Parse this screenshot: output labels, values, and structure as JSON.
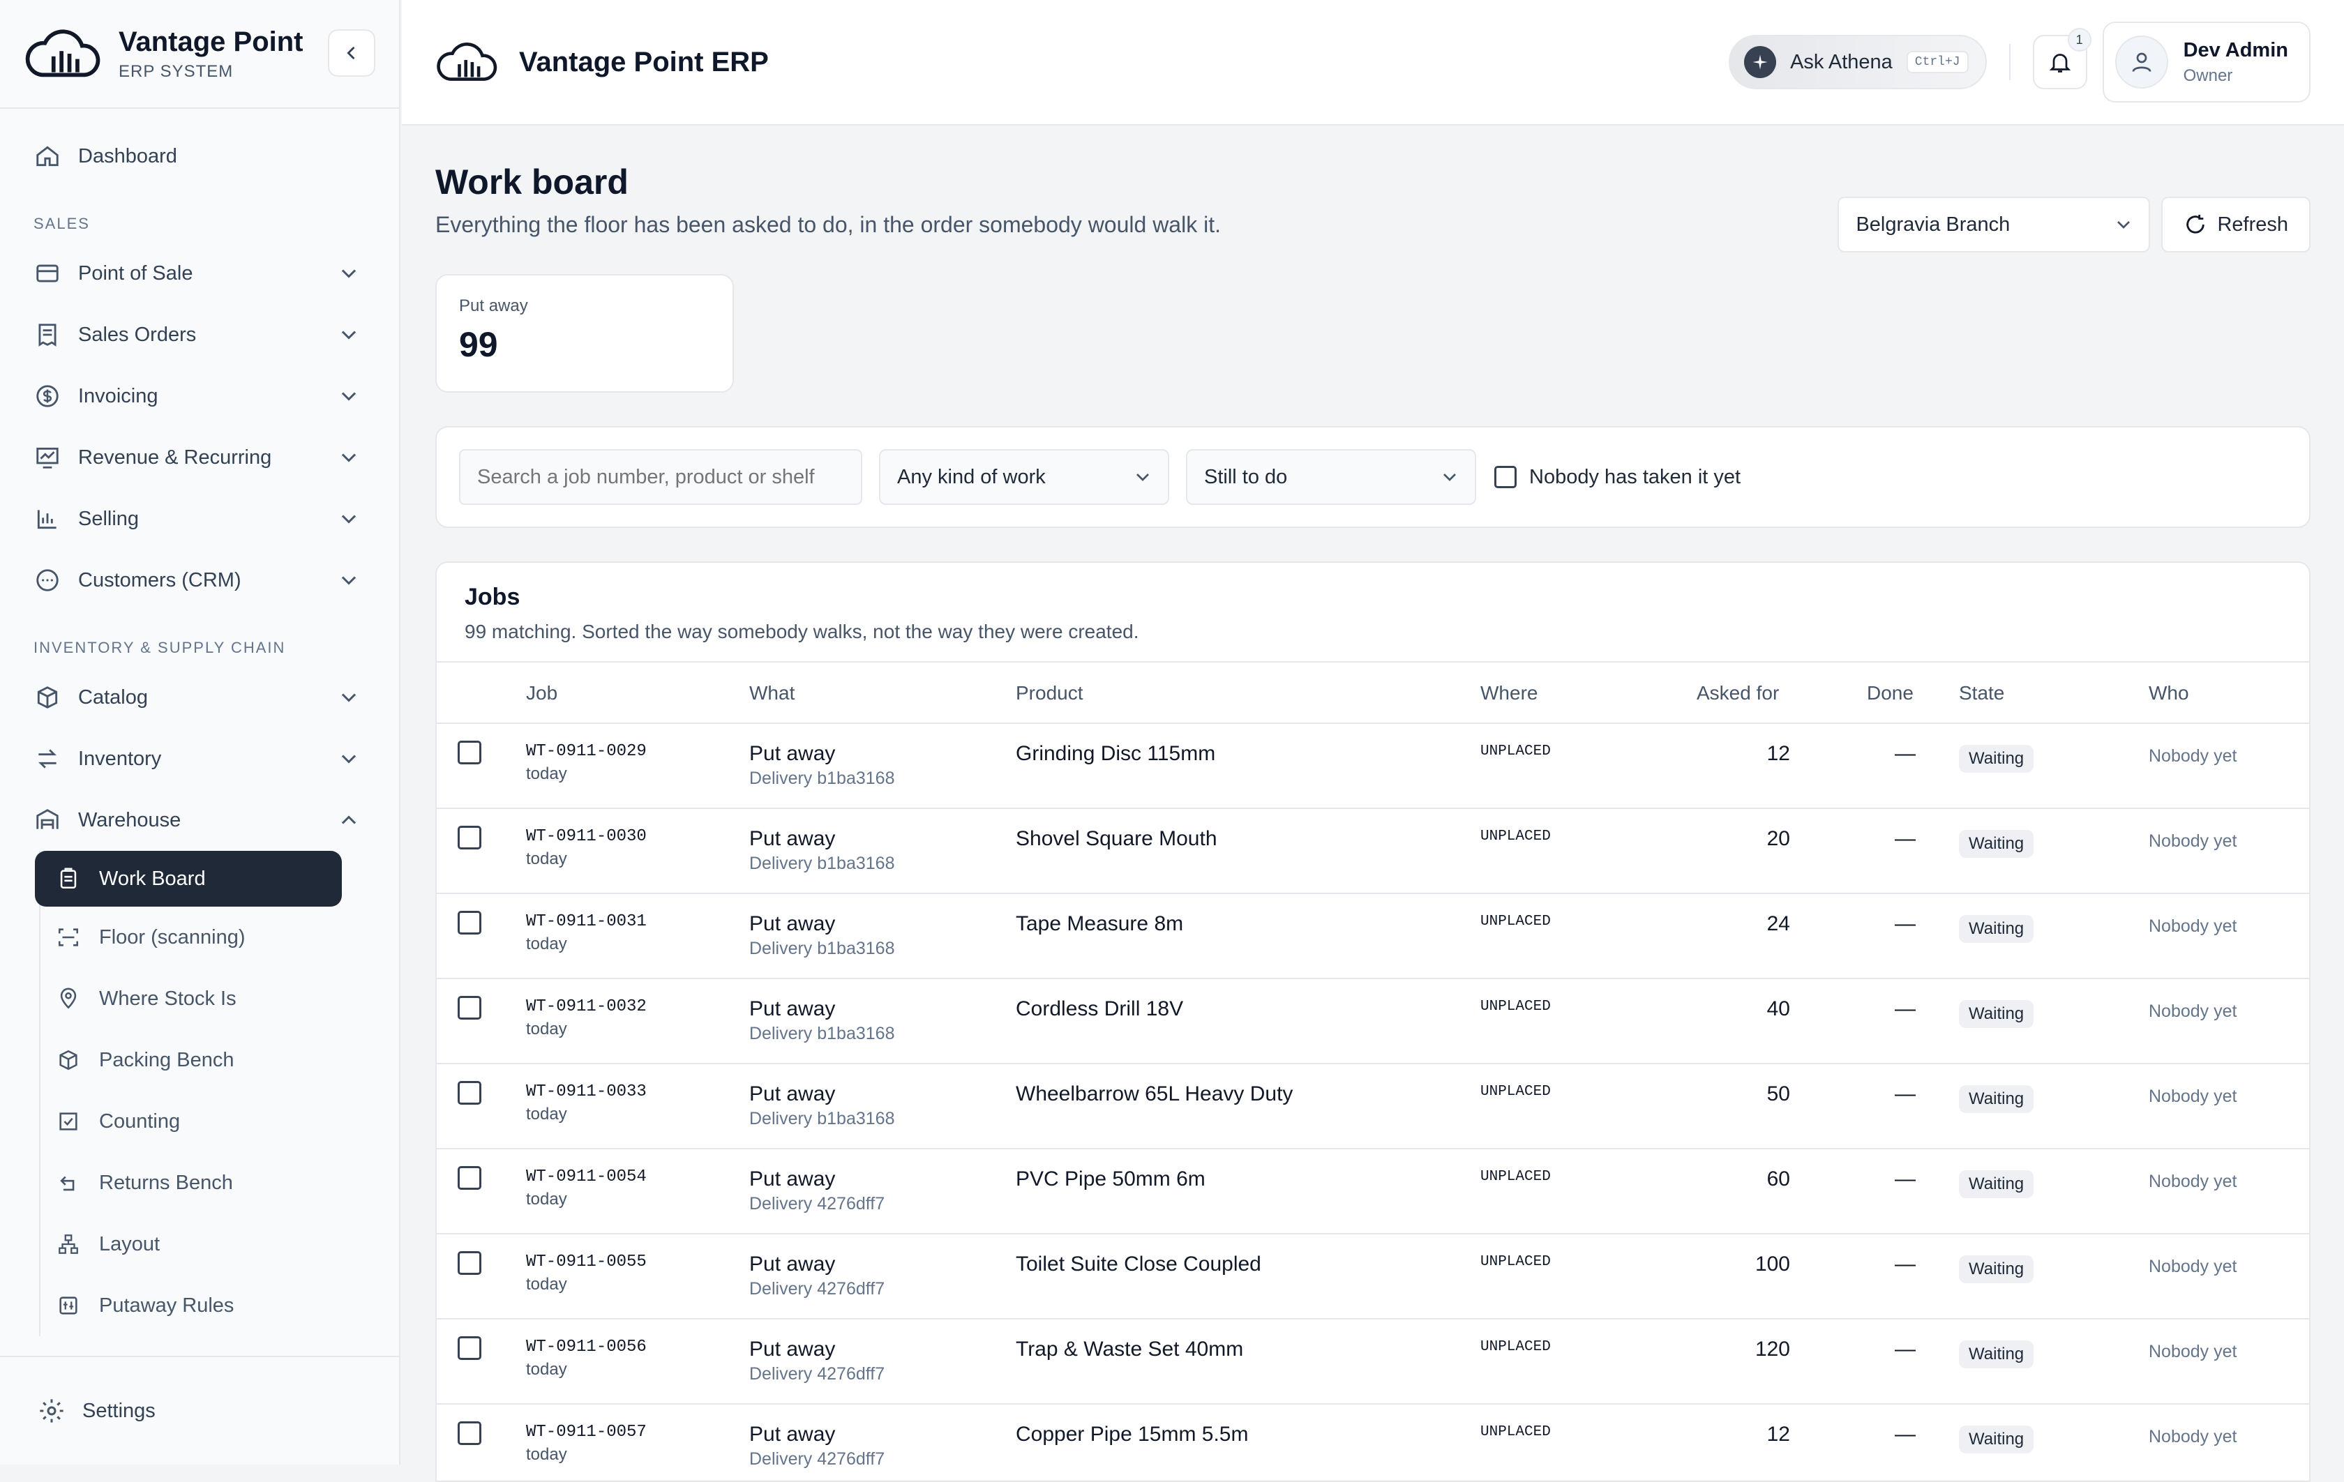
{
  "brand": {
    "title": "Vantage Point",
    "subtitle": "ERP SYSTEM"
  },
  "sidebar": {
    "top_item": {
      "label": "Dashboard",
      "icon": "home-icon"
    },
    "sections": [
      {
        "label": "SALES",
        "items": [
          {
            "label": "Point of Sale",
            "icon": "card-icon"
          },
          {
            "label": "Sales Orders",
            "icon": "receipt-icon"
          },
          {
            "label": "Invoicing",
            "icon": "dollar-icon"
          },
          {
            "label": "Revenue & Recurring",
            "icon": "trend-icon"
          },
          {
            "label": "Selling",
            "icon": "bar-chart-icon"
          },
          {
            "label": "Customers (CRM)",
            "icon": "chat-icon"
          }
        ]
      },
      {
        "label": "INVENTORY & SUPPLY CHAIN",
        "items": [
          {
            "label": "Catalog",
            "icon": "box-icon"
          },
          {
            "label": "Inventory",
            "icon": "arrows-icon"
          },
          {
            "label": "Warehouse",
            "icon": "warehouse-icon"
          }
        ]
      }
    ],
    "warehouse_sub": [
      {
        "label": "Work Board",
        "icon": "clipboard-icon",
        "active": true
      },
      {
        "label": "Floor (scanning)",
        "icon": "scan-icon"
      },
      {
        "label": "Where Stock Is",
        "icon": "pin-icon"
      },
      {
        "label": "Packing Bench",
        "icon": "package-icon"
      },
      {
        "label": "Counting",
        "icon": "check-square-icon"
      },
      {
        "label": "Returns Bench",
        "icon": "return-icon"
      },
      {
        "label": "Layout",
        "icon": "network-icon"
      },
      {
        "label": "Putaway Rules",
        "icon": "rules-icon"
      }
    ],
    "settings_label": "Settings"
  },
  "header": {
    "app_title": "Vantage Point ERP",
    "ask_label": "Ask Athena",
    "ask_shortcut": "Ctrl+J",
    "notification_count": "1",
    "user_name": "Dev Admin",
    "user_role": "Owner"
  },
  "page": {
    "title": "Work board",
    "subtitle": "Everything the floor has been asked to do, in the order somebody would walk it.",
    "branch": "Belgravia Branch",
    "refresh_label": "Refresh"
  },
  "stat": {
    "label": "Put away",
    "value": "99"
  },
  "filters": {
    "search_placeholder": "Search a job number, product or shelf",
    "kind": "Any kind of work",
    "state": "Still to do",
    "unassigned_label": "Nobody has taken it yet"
  },
  "jobs": {
    "title": "Jobs",
    "subtitle": "99 matching. Sorted the way somebody walks, not the way they were created.",
    "columns": [
      "Job",
      "What",
      "Product",
      "Where",
      "Asked for",
      "Done",
      "State",
      "Who"
    ],
    "rows": [
      {
        "job": "WT-0911-0029",
        "when": "today",
        "what": "Put away",
        "source": "Delivery b1ba3168",
        "product": "Grinding Disc 115mm",
        "where": "UNPLACED",
        "asked": "12",
        "done": "—",
        "state": "Waiting",
        "who": "Nobody yet"
      },
      {
        "job": "WT-0911-0030",
        "when": "today",
        "what": "Put away",
        "source": "Delivery b1ba3168",
        "product": "Shovel Square Mouth",
        "where": "UNPLACED",
        "asked": "20",
        "done": "—",
        "state": "Waiting",
        "who": "Nobody yet"
      },
      {
        "job": "WT-0911-0031",
        "when": "today",
        "what": "Put away",
        "source": "Delivery b1ba3168",
        "product": "Tape Measure 8m",
        "where": "UNPLACED",
        "asked": "24",
        "done": "—",
        "state": "Waiting",
        "who": "Nobody yet"
      },
      {
        "job": "WT-0911-0032",
        "when": "today",
        "what": "Put away",
        "source": "Delivery b1ba3168",
        "product": "Cordless Drill 18V",
        "where": "UNPLACED",
        "asked": "40",
        "done": "—",
        "state": "Waiting",
        "who": "Nobody yet"
      },
      {
        "job": "WT-0911-0033",
        "when": "today",
        "what": "Put away",
        "source": "Delivery b1ba3168",
        "product": "Wheelbarrow 65L Heavy Duty",
        "where": "UNPLACED",
        "asked": "50",
        "done": "—",
        "state": "Waiting",
        "who": "Nobody yet"
      },
      {
        "job": "WT-0911-0054",
        "when": "today",
        "what": "Put away",
        "source": "Delivery 4276dff7",
        "product": "PVC Pipe 50mm 6m",
        "where": "UNPLACED",
        "asked": "60",
        "done": "—",
        "state": "Waiting",
        "who": "Nobody yet"
      },
      {
        "job": "WT-0911-0055",
        "when": "today",
        "what": "Put away",
        "source": "Delivery 4276dff7",
        "product": "Toilet Suite Close Coupled",
        "where": "UNPLACED",
        "asked": "100",
        "done": "—",
        "state": "Waiting",
        "who": "Nobody yet"
      },
      {
        "job": "WT-0911-0056",
        "when": "today",
        "what": "Put away",
        "source": "Delivery 4276dff7",
        "product": "Trap & Waste Set 40mm",
        "where": "UNPLACED",
        "asked": "120",
        "done": "—",
        "state": "Waiting",
        "who": "Nobody yet"
      },
      {
        "job": "WT-0911-0057",
        "when": "today",
        "what": "Put away",
        "source": "Delivery 4276dff7",
        "product": "Copper Pipe 15mm 5.5m",
        "where": "UNPLACED",
        "asked": "12",
        "done": "—",
        "state": "Waiting",
        "who": "Nobody yet"
      }
    ]
  }
}
